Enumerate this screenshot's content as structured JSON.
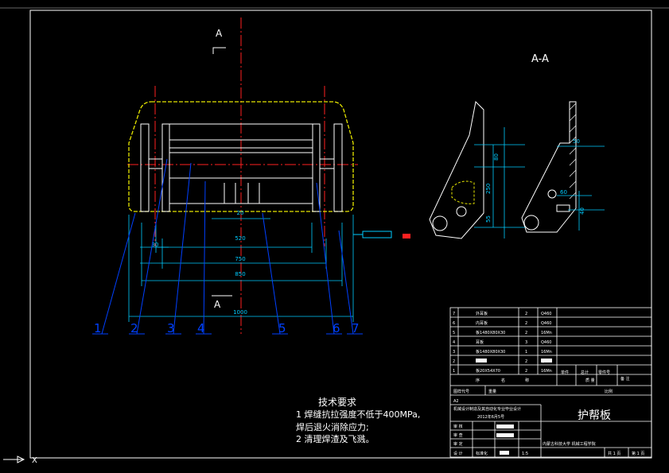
{
  "view_labels": {
    "section_marker_top": "A",
    "section_marker_bottom": "A",
    "section_view_title": "A-A"
  },
  "dimensions": {
    "d_20_top": "20",
    "d_520": "520",
    "d_30": "30",
    "d_750": "750",
    "d_850": "850",
    "d_1000": "1000",
    "d_80": "80",
    "d_250": "250",
    "d_55": "55",
    "d_50": "50",
    "d_40": "40",
    "d_60": "60"
  },
  "part_balloons": [
    "1",
    "2",
    "3",
    "4",
    "5",
    "6",
    "7"
  ],
  "tech_requirements": {
    "title": "技术要求",
    "line1": "1  焊缝抗拉强度不低于400MPa,",
    "line2": "   焊后退火消除应力;",
    "line3": "2  清理焊渣及飞溅。"
  },
  "bom_rows": [
    {
      "no": "7",
      "name": "外耳板",
      "qty": "2",
      "mat": "Q460"
    },
    {
      "no": "6",
      "name": "内耳板",
      "qty": "2",
      "mat": "Q460"
    },
    {
      "no": "5",
      "name": "板1480X80X30",
      "qty": "2",
      "mat": "16Mn"
    },
    {
      "no": "4",
      "name": "耳板",
      "qty": "3",
      "mat": "Q460"
    },
    {
      "no": "3",
      "name": "板1480X80X30",
      "qty": "1",
      "mat": "16Mn"
    },
    {
      "no": "2",
      "name": "",
      "qty": "2",
      "mat": "Q460"
    },
    {
      "no": "1",
      "name": "板20X54X70",
      "qty": "2",
      "mat": "16Mn"
    }
  ],
  "title_block": {
    "hdr_no": "序",
    "hdr_name": "名",
    "hdr_qty": "称",
    "hdr_single": "单件",
    "hdr_total": "总计",
    "hdr_remark": "备 注",
    "hdr_mass": "质 量",
    "hdr_material": "零件号",
    "drawing_no_label": "图样代号",
    "revision": "A2",
    "project_line": "机械设计制造及其自动化专业毕业设计",
    "date_line": "2012年6月5号",
    "drawing_title": "护帮板",
    "scale": "1:5",
    "school": "内蒙古科技大学 机械工程学院",
    "role_review": "审 核",
    "role_check": "审 查",
    "role_approve": "审 定",
    "role_design": "设 计",
    "role_std": "标准化",
    "sheets_total": "共 1 页",
    "sheet_no": "第 1 页",
    "weight_label": "重量",
    "ratio_label": "比例"
  },
  "colors": {
    "background": "#000000",
    "frame": "#ffffff",
    "centerline": "#ff2020",
    "dimension": "#00ccff",
    "outline": "#e6e600",
    "leader": "#0040ff",
    "hidden": "#ffffff"
  }
}
